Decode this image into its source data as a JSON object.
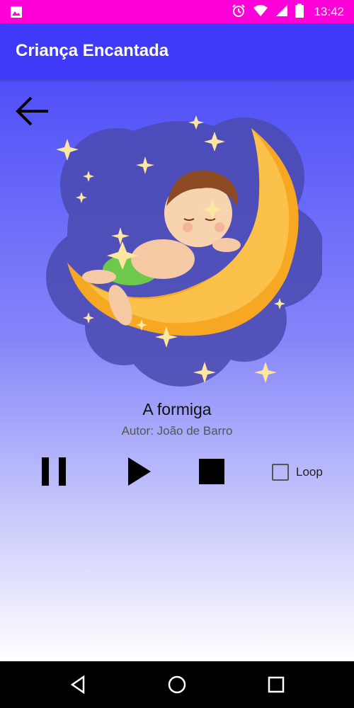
{
  "status_bar": {
    "time": "13:42",
    "left_icon": "image-icon",
    "icons": [
      "alarm-icon",
      "wifi-icon",
      "signal-icon",
      "battery-icon"
    ],
    "background": "#ff00d8"
  },
  "app_bar": {
    "title": "Criança Encantada",
    "background": "#3f3af7"
  },
  "player": {
    "back_icon": "back-arrow-icon",
    "artwork": "baby-sleeping-on-moon-illustration",
    "title": "A formiga",
    "author": "Autor: João de Barro",
    "controls": {
      "pause_icon": "pause-icon",
      "play_icon": "play-icon",
      "stop_icon": "stop-icon"
    },
    "loop": {
      "label": "Loop",
      "checked": false
    }
  },
  "nav_bar": {
    "icons": [
      "back-triangle-icon",
      "home-circle-icon",
      "recents-square-icon"
    ]
  }
}
